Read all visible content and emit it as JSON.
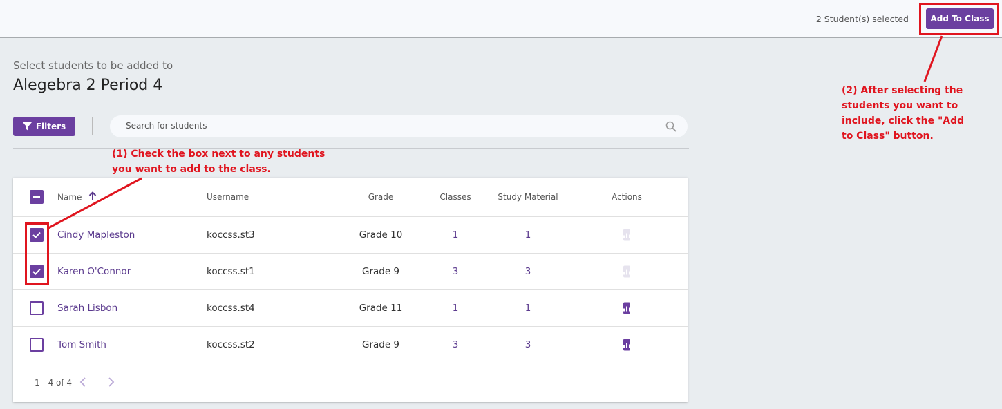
{
  "topbar": {
    "selected_count": "2 Student(s) selected",
    "add_button": "Add To Class"
  },
  "page": {
    "subtitle": "Select students to be added to",
    "title": "Alegebra 2 Period 4"
  },
  "toolbar": {
    "filters_label": "Filters",
    "search_placeholder": "Search for students",
    "search_value": ""
  },
  "table": {
    "headers": {
      "name": "Name",
      "username": "Username",
      "grade": "Grade",
      "classes": "Classes",
      "study_material": "Study Material",
      "actions": "Actions"
    },
    "sort": {
      "column": "Name",
      "direction": "ascending"
    },
    "select_all_state": "indeterminate",
    "rows": [
      {
        "name": "Cindy Mapleston",
        "username": "koccss.st3",
        "grade": "Grade 10",
        "classes": "1",
        "study_material": "1",
        "checked": true,
        "action_enabled": false
      },
      {
        "name": "Karen O'Connor",
        "username": "koccss.st1",
        "grade": "Grade 9",
        "classes": "3",
        "study_material": "3",
        "checked": true,
        "action_enabled": false
      },
      {
        "name": "Sarah Lisbon",
        "username": "koccss.st4",
        "grade": "Grade 11",
        "classes": "1",
        "study_material": "1",
        "checked": false,
        "action_enabled": true
      },
      {
        "name": "Tom Smith",
        "username": "koccss.st2",
        "grade": "Grade 9",
        "classes": "3",
        "study_material": "3",
        "checked": false,
        "action_enabled": true
      }
    ]
  },
  "pagination": {
    "range": "1 - 4 of 4"
  },
  "annotations": {
    "step1": "(1) Check the box next to any students you want to add to the class.",
    "step2": "(2) After selecting the students you want to include, click the \"Add to Class\" button."
  },
  "colors": {
    "accent": "#6b3fa0",
    "annotation": "#e0151f",
    "background": "#e9edf0"
  },
  "icons": [
    "filter-icon",
    "search-icon",
    "sort-arrow-up-icon",
    "bar-chart-icon",
    "chevron-left-icon",
    "chevron-right-icon",
    "checkbox-icon"
  ]
}
